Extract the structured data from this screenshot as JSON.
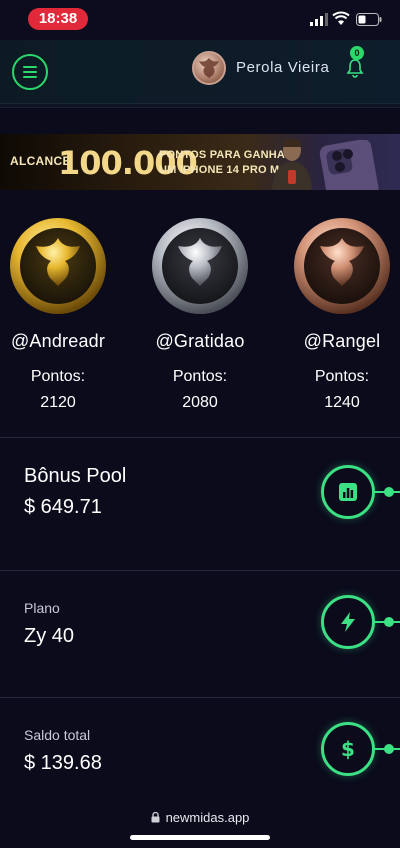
{
  "status_bar": {
    "time": "18:38"
  },
  "header": {
    "user_name": "Perola Vieira",
    "notification_count": "0"
  },
  "banner": {
    "word1": "ALCANCE",
    "number": "100.000",
    "line1": "PONTOS PARA GANHAR",
    "line2": "UM IPHONE 14 PRO MAX"
  },
  "ranking": [
    {
      "user": "@Andreadr",
      "label": "Pontos:",
      "points": "2120",
      "medal": "gold"
    },
    {
      "user": "@Gratidao",
      "label": "Pontos:",
      "points": "2080",
      "medal": "silver"
    },
    {
      "user": "@Rangel",
      "label": "Pontos:",
      "points": "1240",
      "medal": "bronze"
    }
  ],
  "cards": {
    "bonus": {
      "title": "Bônus Pool",
      "value": "$ 649.71",
      "icon": "chart-icon"
    },
    "plan": {
      "label": "Plano",
      "value": "Zy 40",
      "icon": "lightning-icon"
    },
    "balance": {
      "label": "Saldo total",
      "value": "$ 139.68",
      "icon": "dollar-icon"
    }
  },
  "browser": {
    "url": "newmidas.app"
  },
  "colors": {
    "accent": "#3ce184",
    "background": "#0b0b1c",
    "time_pill": "#e2293a"
  }
}
